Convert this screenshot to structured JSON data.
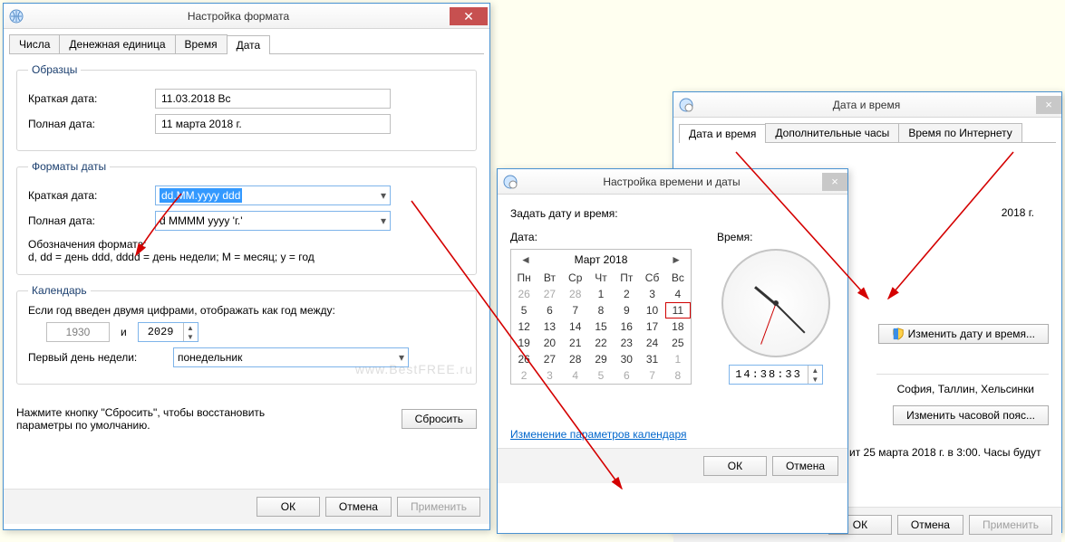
{
  "win1": {
    "title": "Настройка формата",
    "tabs": [
      "Числа",
      "Денежная единица",
      "Время",
      "Дата"
    ],
    "active_tab": "Дата",
    "samples": {
      "legend": "Образцы",
      "short_lbl": "Краткая дата:",
      "short_val": "11.03.2018 Вс",
      "long_lbl": "Полная дата:",
      "long_val": "11 марта 2018 г."
    },
    "formats": {
      "legend": "Форматы даты",
      "short_lbl": "Краткая дата:",
      "short_val": "dd.MM.yyyy ddd",
      "long_lbl": "Полная дата:",
      "long_val": "d MMMM yyyy 'г.'",
      "notation_lbl": "Обозначения формата:",
      "notation_val": "d, dd = день  ddd, dddd = день недели; M = месяц; y = год"
    },
    "calendar": {
      "legend": "Календарь",
      "range_lbl": "Если год введен двумя цифрами, отображать как год между:",
      "from": "1930",
      "and": "и",
      "to": "2029",
      "first_day_lbl": "Первый день недели:",
      "first_day_val": "понедельник"
    },
    "reset_hint": "Нажмите кнопку \"Сбросить\", чтобы восстановить параметры по умолчанию.",
    "reset_btn": "Сбросить",
    "ok": "ОК",
    "cancel": "Отмена",
    "apply": "Применить",
    "watermark": "www.BestFREE.ru"
  },
  "win2": {
    "title": "Настройка времени и даты",
    "set_lbl": "Задать дату и время:",
    "date_lbl": "Дата:",
    "time_lbl": "Время:",
    "cal": {
      "month": "Март 2018",
      "dow": [
        "Пн",
        "Вт",
        "Ср",
        "Чт",
        "Пт",
        "Сб",
        "Вс"
      ],
      "prev_grey": [
        26,
        27,
        28
      ],
      "days": [
        1,
        2,
        3,
        4,
        5,
        6,
        7,
        8,
        9,
        10,
        11,
        12,
        13,
        14,
        15,
        16,
        17,
        18,
        19,
        20,
        21,
        22,
        23,
        24,
        25,
        26,
        27,
        28,
        29,
        30,
        31
      ],
      "next_grey": [
        1,
        2,
        3,
        4,
        5,
        6,
        7,
        8
      ],
      "today": 11
    },
    "time_val": "14:38:33",
    "link": "Изменение параметров календаря",
    "ok": "ОК",
    "cancel": "Отмена"
  },
  "win3": {
    "title": "Дата и время",
    "tabs": [
      "Дата и время",
      "Дополнительные часы",
      "Время по Интернету"
    ],
    "active_tab": "Дата и время",
    "date_frag": "2018 г.",
    "btn_change_dt": "Изменить дату и время...",
    "tz_frag": "София, Таллин, Хельсинки",
    "btn_change_tz": "Изменить часовой пояс...",
    "dst_frag": "ит 25 марта 2018 г. в 3:00. Часы будут",
    "ok": "ОК",
    "cancel": "Отмена",
    "apply": "Применить"
  }
}
